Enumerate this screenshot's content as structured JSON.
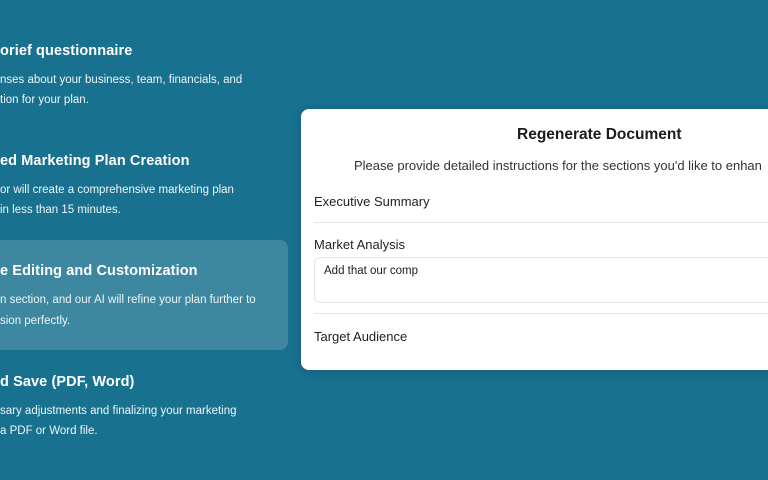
{
  "steps": [
    {
      "title": "orief questionnaire",
      "desc_line1": "nses about your business, team, financials, and",
      "desc_line2": "tion for your plan."
    },
    {
      "title": "ed Marketing Plan Creation",
      "desc_line1": "or will create a comprehensive marketing plan",
      "desc_line2": "in less than 15 minutes."
    },
    {
      "title": "e Editing and Customization",
      "desc_line1": "n section, and our AI will refine your plan further to",
      "desc_line2": "sion perfectly."
    },
    {
      "title": "d Save (PDF, Word)",
      "desc_line1": "sary adjustments and finalizing your marketing",
      "desc_line2": " a PDF or Word file."
    }
  ],
  "modal": {
    "title": "Regenerate Document",
    "subtitle": "Please provide detailed instructions for the sections you'd like to enhan",
    "sections": [
      {
        "label": "Executive Summary"
      },
      {
        "label": "Market Analysis",
        "input_value": "Add that our comp"
      },
      {
        "label": "Target Audience"
      }
    ]
  },
  "colors": {
    "background": "#18718f",
    "active_step": "rgba(255,255,255,0.16)",
    "modal": "#ffffff"
  }
}
